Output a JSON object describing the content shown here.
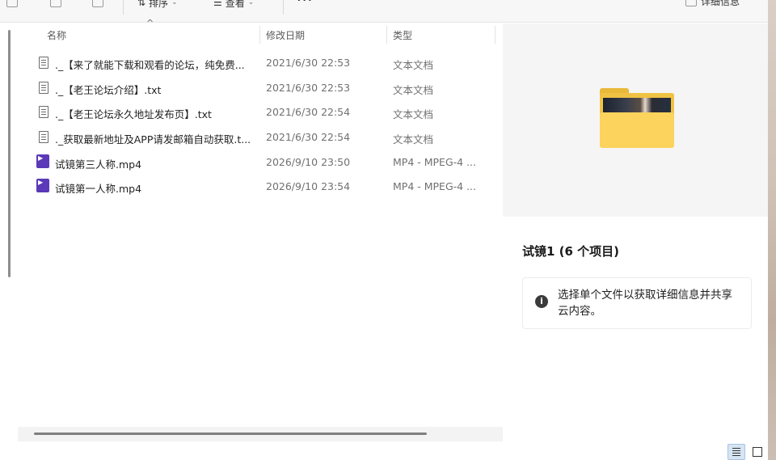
{
  "toolbar": {
    "sort_label": "排序",
    "view_label": "查看",
    "more_label": "···",
    "details_label": "详细信息"
  },
  "columns": {
    "name": "名称",
    "date": "修改日期",
    "type": "类型"
  },
  "files": [
    {
      "name": "._【来了就能下载和观看的论坛，纯免费...",
      "date": "2021/6/30 22:53",
      "type": "文本文档",
      "icon": "text-file-icon"
    },
    {
      "name": "._【老王论坛介绍】.txt",
      "date": "2021/6/30 22:53",
      "type": "文本文档",
      "icon": "text-file-icon"
    },
    {
      "name": "._【老王论坛永久地址发布页】.txt",
      "date": "2021/6/30 22:54",
      "type": "文本文档",
      "icon": "text-file-icon"
    },
    {
      "name": "._获取最新地址及APP请发邮箱自动获取.t...",
      "date": "2021/6/30 22:54",
      "type": "文本文档",
      "icon": "text-file-icon"
    },
    {
      "name": "试镜第三人称.mp4",
      "date": "2026/9/10 23:50",
      "type": "MP4 - MPEG-4 ...",
      "icon": "video-file-icon"
    },
    {
      "name": "试镜第一人称.mp4",
      "date": "2026/9/10 23:54",
      "type": "MP4 - MPEG-4 ...",
      "icon": "video-file-icon"
    }
  ],
  "details": {
    "folder_title": "试镜1 (6 个项目)",
    "info_text": "选择单个文件以获取详细信息并共享云内容。",
    "info_icon_glyph": "i"
  }
}
